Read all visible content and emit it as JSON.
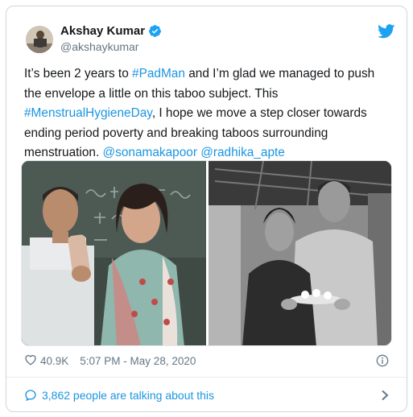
{
  "tweet": {
    "author": {
      "name": "Akshay Kumar",
      "handle": "@akshaykumar"
    },
    "text_lines": [
      [
        {
          "t": "It’s been 2 years to ",
          "link": false
        },
        {
          "t": "#PadMan",
          "link": true
        },
        {
          "t": " and I’m glad we managed to push",
          "link": false
        }
      ],
      [
        {
          "t": "the envelope a little on this taboo subject. This",
          "link": false
        }
      ],
      [
        {
          "t": "#MenstrualHygieneDay",
          "link": true
        },
        {
          "t": ", I hope we move a step closer towards",
          "link": false
        }
      ],
      [
        {
          "t": "ending period poverty and breaking taboos surrounding",
          "link": false
        }
      ],
      [
        {
          "t": "menstruation. ",
          "link": false
        },
        {
          "t": "@sonamakapoor",
          "link": true
        },
        {
          "t": " ",
          "link": false
        },
        {
          "t": "@radhika_apte",
          "link": true
        }
      ]
    ],
    "likes": "40.9K",
    "timestamp": "5:07 PM - May 28, 2020",
    "talking": "3,862 people are talking about this"
  },
  "icons": {
    "verified": "verified-badge-icon",
    "twitter": "twitter-bird-icon",
    "heart": "heart-icon",
    "info": "info-icon",
    "comment": "comment-bubble-icon",
    "chevron": "chevron-right-icon"
  },
  "colors": {
    "text": "#14171a",
    "secondary": "#657786",
    "link": "#1b95e0",
    "border": "#ccd6dd"
  }
}
